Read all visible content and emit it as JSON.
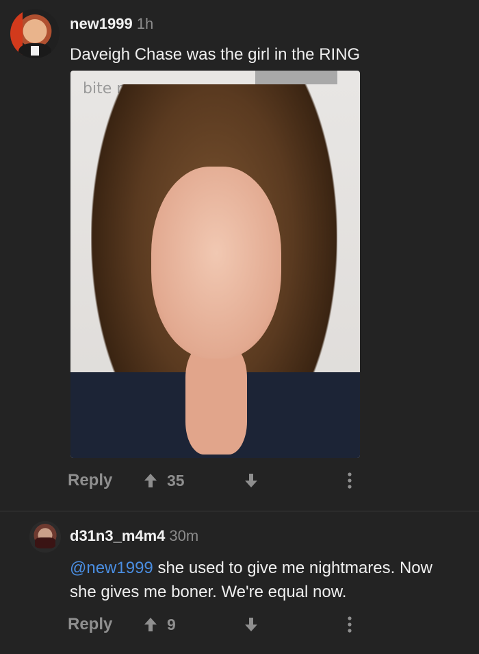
{
  "comments": [
    {
      "username": "new1999",
      "age": "1h",
      "text": "Daveigh Chase was the girl in the RING",
      "image_logo_text": "bite me",
      "reply_label": "Reply",
      "upvotes": "35"
    },
    {
      "username": "d31n3_m4m4",
      "age": "30m",
      "mention": "@new1999",
      "text": " she used to give me nightmares. Now she gives me boner. We're equal now.",
      "reply_label": "Reply",
      "upvotes": "9"
    }
  ],
  "colors": {
    "background": "#232323",
    "mention": "#4a8ee2",
    "muted": "#8f8f8f"
  },
  "icons": {
    "upvote": "arrow-up-icon",
    "downvote": "arrow-down-icon",
    "more": "vertical-dots-icon"
  }
}
